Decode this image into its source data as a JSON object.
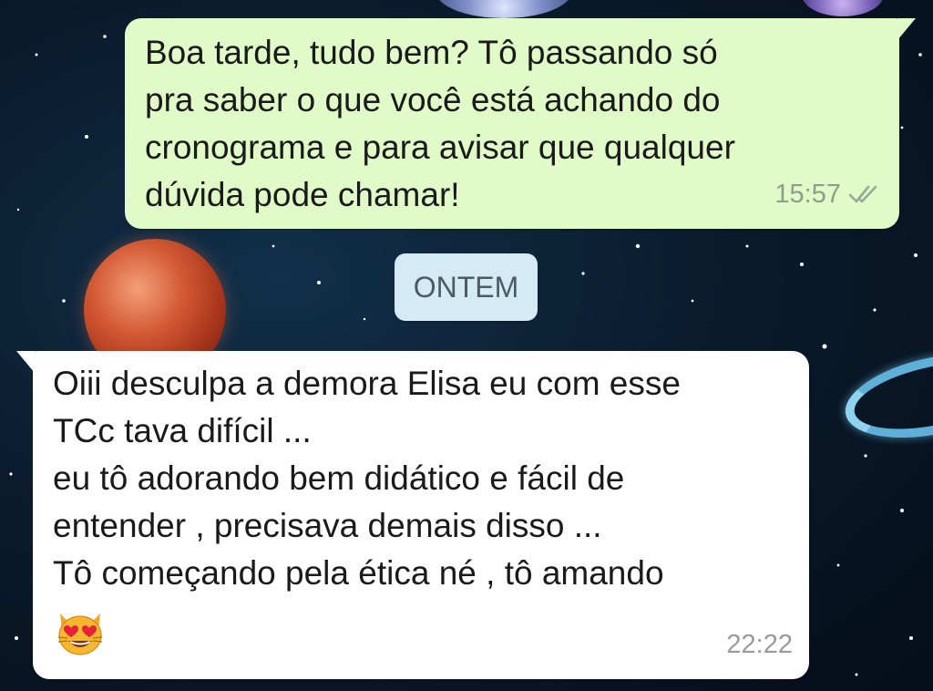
{
  "chat": {
    "messages": [
      {
        "direction": "outgoing",
        "text": "Boa tarde, tudo bem? Tô passando só\npra saber o que você está achando do\ncronograma e para avisar que qualquer\ndúvida pode chamar!",
        "time": "15:57",
        "status_icon": "double-check-icon"
      },
      {
        "direction": "incoming",
        "text": "Oiii desculpa a demora Elisa eu com esse\nTCc tava difícil ...\neu tô adorando bem didático e fácil de\nentender , precisava demais disso ...\nTô começando pela ética né , tô amando",
        "emoji": "heart-eyes-cat-icon",
        "time": "22:22"
      }
    ],
    "date_separator": "ONTEM"
  },
  "colors": {
    "outgoing_bubble": "#e1fbc8",
    "incoming_bubble": "#ffffff",
    "date_chip": "#d4eaf5",
    "background": "#0a1c2e"
  }
}
